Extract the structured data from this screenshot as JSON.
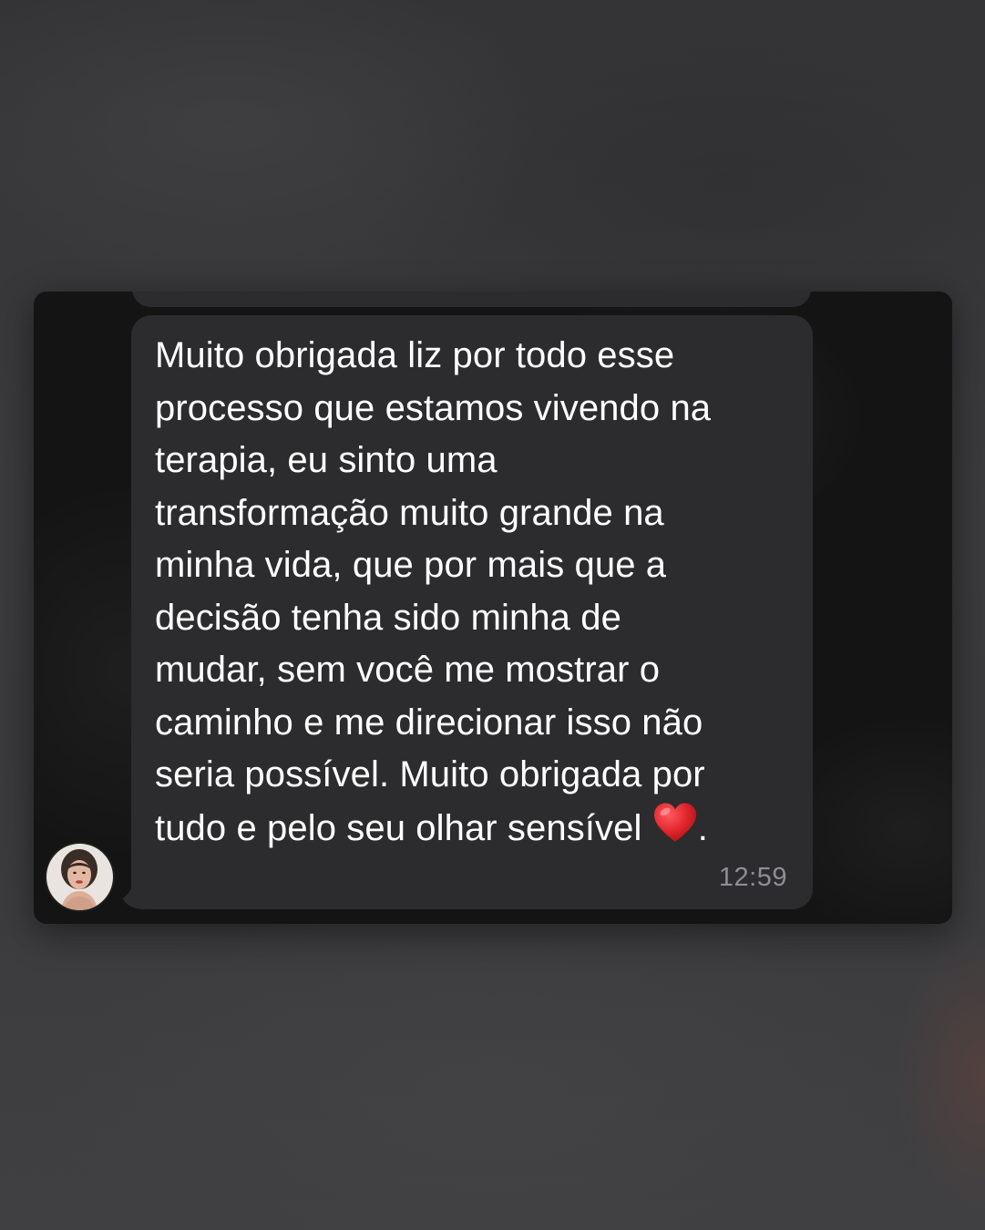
{
  "message": {
    "line_1": "Muito obrigada liz por todo esse",
    "line_2": "processo que estamos vivendo na",
    "line_3": "terapia, eu sinto uma",
    "line_4": "transformação muito grande na",
    "line_5": "minha vida, que por mais que a",
    "line_6": "decisão tenha sido minha de",
    "line_7": "mudar, sem você me mostrar o",
    "line_8": "caminho e me direcionar isso não",
    "line_9": "seria possível. Muito obrigada por",
    "line_10_start": "tudo e pelo seu olhar sensível ",
    "line_10_end": ".",
    "emoji": "red-heart",
    "time": "12:59"
  },
  "sender": {
    "avatar_icon": "person-avatar-icon"
  },
  "colors": {
    "bubble": "#2c2c2e",
    "card": "#141414",
    "page": "#3a3a3c",
    "text": "#ffffff",
    "timestamp": "#8e8e93",
    "heart": "#e0242b"
  }
}
